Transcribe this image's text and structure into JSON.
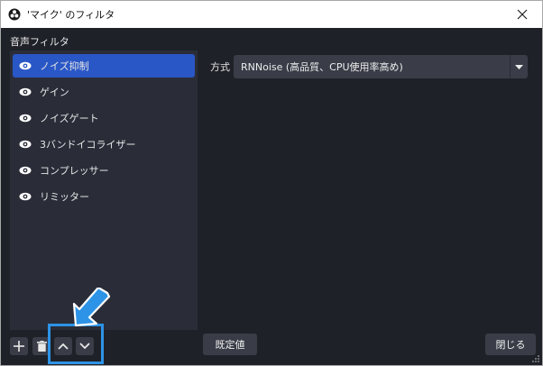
{
  "window": {
    "title": "'マイク' のフィルタ"
  },
  "sidebar": {
    "heading": "音声フィルタ",
    "items": [
      {
        "label": "ノイズ抑制",
        "selected": true
      },
      {
        "label": "ゲイン",
        "selected": false
      },
      {
        "label": "ノイズゲート",
        "selected": false
      },
      {
        "label": "3バンドイコライザー",
        "selected": false
      },
      {
        "label": "コンプレッサー",
        "selected": false
      },
      {
        "label": "リミッター",
        "selected": false
      }
    ]
  },
  "settings": {
    "method_label": "方式",
    "method_value": "RNNoise (高品質、CPU使用率高め)"
  },
  "footer": {
    "defaults_label": "既定値",
    "close_label": "閉じる"
  },
  "icons": {
    "add": "plus-icon",
    "remove": "trash-icon",
    "move_up": "chevron-up-icon",
    "move_down": "chevron-down-icon",
    "visibility": "eye-icon"
  },
  "colors": {
    "background": "#1f2128",
    "panel": "#2a2d38",
    "selected": "#2a57c6",
    "button": "#3a3d48",
    "annotation": "#2d93e6"
  }
}
